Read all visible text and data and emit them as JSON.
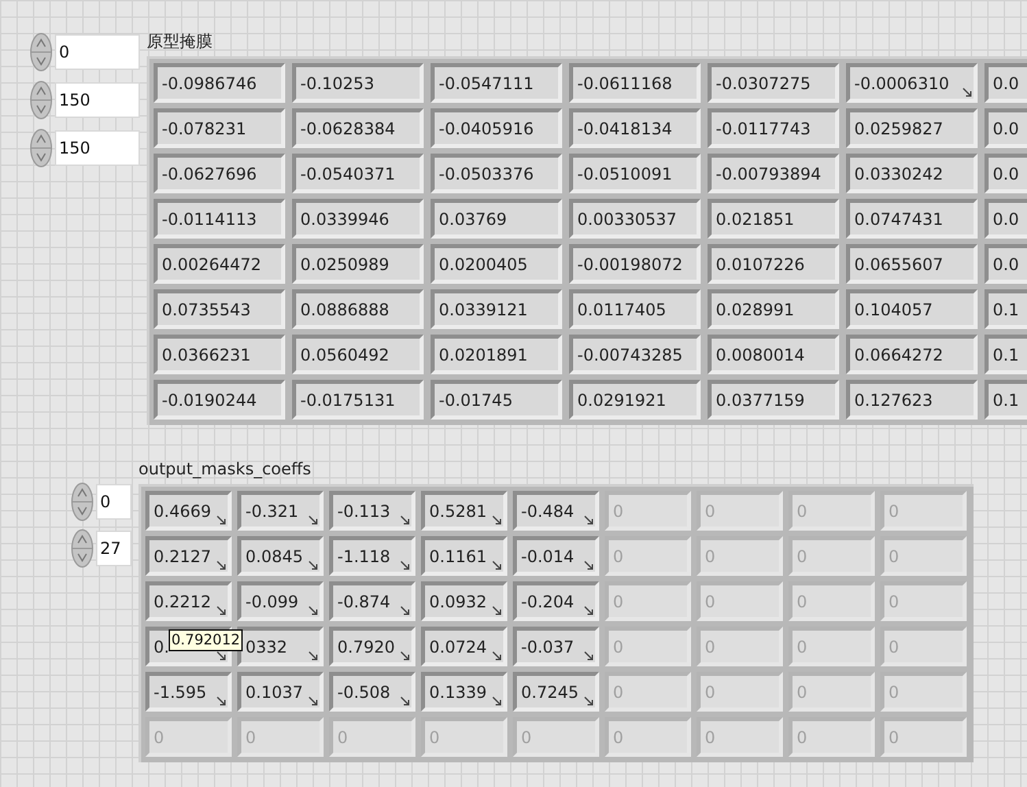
{
  "arrays": [
    {
      "label": "原型掩膜",
      "indices": [
        {
          "value": "0"
        },
        {
          "value": "150"
        },
        {
          "value": "150"
        }
      ],
      "rows": [
        {
          "cells": [
            {
              "text": "-0.0986746",
              "overflow": false
            },
            {
              "text": "-0.10253",
              "overflow": false
            },
            {
              "text": "-0.0547111",
              "overflow": false
            },
            {
              "text": "-0.0611168",
              "overflow": false
            },
            {
              "text": "-0.0307275",
              "overflow": false
            },
            {
              "text": "-0.0006310",
              "overflow": true
            },
            {
              "text": "0.0",
              "overflow": false
            }
          ]
        },
        {
          "cells": [
            {
              "text": "-0.078231",
              "overflow": false
            },
            {
              "text": "-0.0628384",
              "overflow": false
            },
            {
              "text": "-0.0405916",
              "overflow": false
            },
            {
              "text": "-0.0418134",
              "overflow": false
            },
            {
              "text": "-0.0117743",
              "overflow": false
            },
            {
              "text": "0.0259827",
              "overflow": false
            },
            {
              "text": "0.0",
              "overflow": false
            }
          ]
        },
        {
          "cells": [
            {
              "text": "-0.0627696",
              "overflow": false
            },
            {
              "text": "-0.0540371",
              "overflow": false
            },
            {
              "text": "-0.0503376",
              "overflow": false
            },
            {
              "text": "-0.0510091",
              "overflow": false
            },
            {
              "text": "-0.00793894",
              "overflow": false
            },
            {
              "text": "0.0330242",
              "overflow": false
            },
            {
              "text": "0.0",
              "overflow": false
            }
          ]
        },
        {
          "cells": [
            {
              "text": "-0.0114113",
              "overflow": false
            },
            {
              "text": "0.0339946",
              "overflow": false
            },
            {
              "text": "0.03769",
              "overflow": false
            },
            {
              "text": "0.00330537",
              "overflow": false
            },
            {
              "text": "0.021851",
              "overflow": false
            },
            {
              "text": "0.0747431",
              "overflow": false
            },
            {
              "text": "0.0",
              "overflow": false
            }
          ]
        },
        {
          "cells": [
            {
              "text": "0.00264472",
              "overflow": false
            },
            {
              "text": "0.0250989",
              "overflow": false
            },
            {
              "text": "0.0200405",
              "overflow": false
            },
            {
              "text": "-0.00198072",
              "overflow": false
            },
            {
              "text": "0.0107226",
              "overflow": false
            },
            {
              "text": "0.0655607",
              "overflow": false
            },
            {
              "text": "0.0",
              "overflow": false
            }
          ]
        },
        {
          "cells": [
            {
              "text": "0.0735543",
              "overflow": false
            },
            {
              "text": "0.0886888",
              "overflow": false
            },
            {
              "text": "0.0339121",
              "overflow": false
            },
            {
              "text": "0.0117405",
              "overflow": false
            },
            {
              "text": "0.028991",
              "overflow": false
            },
            {
              "text": "0.104057",
              "overflow": false
            },
            {
              "text": "0.1",
              "overflow": false
            }
          ]
        },
        {
          "cells": [
            {
              "text": "0.0366231",
              "overflow": false
            },
            {
              "text": "0.0560492",
              "overflow": false
            },
            {
              "text": "0.0201891",
              "overflow": false
            },
            {
              "text": "-0.00743285",
              "overflow": false
            },
            {
              "text": "0.0080014",
              "overflow": false
            },
            {
              "text": "0.0664272",
              "overflow": false
            },
            {
              "text": "0.1",
              "overflow": false
            }
          ]
        },
        {
          "cells": [
            {
              "text": "-0.0190244",
              "overflow": false
            },
            {
              "text": "-0.0175131",
              "overflow": false
            },
            {
              "text": "-0.01745",
              "overflow": false
            },
            {
              "text": "0.0291921",
              "overflow": false
            },
            {
              "text": "0.0377159",
              "overflow": false
            },
            {
              "text": "0.127623",
              "overflow": false
            },
            {
              "text": "0.1",
              "overflow": false
            }
          ]
        }
      ]
    },
    {
      "label": "output_masks_coeffs",
      "indices": [
        {
          "value": "0"
        },
        {
          "value": "27"
        }
      ],
      "tooltip": "0.792012",
      "rows": [
        {
          "cells": [
            {
              "text": "0.4669",
              "overflow": true,
              "greyed": false
            },
            {
              "text": "-0.321",
              "overflow": true,
              "greyed": false
            },
            {
              "text": "-0.113",
              "overflow": true,
              "greyed": false
            },
            {
              "text": "0.5281",
              "overflow": true,
              "greyed": false
            },
            {
              "text": "-0.484",
              "overflow": true,
              "greyed": false
            },
            {
              "text": "0",
              "overflow": false,
              "greyed": true
            },
            {
              "text": "0",
              "overflow": false,
              "greyed": true
            },
            {
              "text": "0",
              "overflow": false,
              "greyed": true
            },
            {
              "text": "0",
              "overflow": false,
              "greyed": true
            }
          ]
        },
        {
          "cells": [
            {
              "text": "0.2127",
              "overflow": true,
              "greyed": false
            },
            {
              "text": "0.0845",
              "overflow": true,
              "greyed": false
            },
            {
              "text": "-1.118",
              "overflow": true,
              "greyed": false
            },
            {
              "text": "0.1161",
              "overflow": true,
              "greyed": false
            },
            {
              "text": "-0.014",
              "overflow": true,
              "greyed": false
            },
            {
              "text": "0",
              "overflow": false,
              "greyed": true
            },
            {
              "text": "0",
              "overflow": false,
              "greyed": true
            },
            {
              "text": "0",
              "overflow": false,
              "greyed": true
            },
            {
              "text": "0",
              "overflow": false,
              "greyed": true
            }
          ]
        },
        {
          "cells": [
            {
              "text": "0.2212",
              "overflow": true,
              "greyed": false
            },
            {
              "text": "-0.099",
              "overflow": true,
              "greyed": false
            },
            {
              "text": "-0.874",
              "overflow": true,
              "greyed": false
            },
            {
              "text": "0.0932",
              "overflow": true,
              "greyed": false
            },
            {
              "text": "-0.204",
              "overflow": true,
              "greyed": false
            },
            {
              "text": "0",
              "overflow": false,
              "greyed": true
            },
            {
              "text": "0",
              "overflow": false,
              "greyed": true
            },
            {
              "text": "0",
              "overflow": false,
              "greyed": true
            },
            {
              "text": "0",
              "overflow": false,
              "greyed": true
            }
          ]
        },
        {
          "cells": [
            {
              "text": "0.",
              "overflow": true,
              "greyed": false
            },
            {
              "text": "0332",
              "overflow": true,
              "greyed": false
            },
            {
              "text": "0.7920",
              "overflow": true,
              "greyed": false
            },
            {
              "text": "0.0724",
              "overflow": true,
              "greyed": false
            },
            {
              "text": "-0.037",
              "overflow": true,
              "greyed": false
            },
            {
              "text": "0",
              "overflow": false,
              "greyed": true
            },
            {
              "text": "0",
              "overflow": false,
              "greyed": true
            },
            {
              "text": "0",
              "overflow": false,
              "greyed": true
            },
            {
              "text": "0",
              "overflow": false,
              "greyed": true
            }
          ]
        },
        {
          "cells": [
            {
              "text": "-1.595",
              "overflow": true,
              "greyed": false
            },
            {
              "text": "0.1037",
              "overflow": true,
              "greyed": false
            },
            {
              "text": "-0.508",
              "overflow": true,
              "greyed": false
            },
            {
              "text": "0.1339",
              "overflow": true,
              "greyed": false
            },
            {
              "text": "0.7245",
              "overflow": true,
              "greyed": false
            },
            {
              "text": "0",
              "overflow": false,
              "greyed": true
            },
            {
              "text": "0",
              "overflow": false,
              "greyed": true
            },
            {
              "text": "0",
              "overflow": false,
              "greyed": true
            },
            {
              "text": "0",
              "overflow": false,
              "greyed": true
            }
          ]
        },
        {
          "cells": [
            {
              "text": "0",
              "overflow": false,
              "greyed": true
            },
            {
              "text": "0",
              "overflow": false,
              "greyed": true
            },
            {
              "text": "0",
              "overflow": false,
              "greyed": true
            },
            {
              "text": "0",
              "overflow": false,
              "greyed": true
            },
            {
              "text": "0",
              "overflow": false,
              "greyed": true
            },
            {
              "text": "0",
              "overflow": false,
              "greyed": true
            },
            {
              "text": "0",
              "overflow": false,
              "greyed": true
            },
            {
              "text": "0",
              "overflow": false,
              "greyed": true
            },
            {
              "text": "0",
              "overflow": false,
              "greyed": true
            }
          ]
        }
      ]
    }
  ]
}
